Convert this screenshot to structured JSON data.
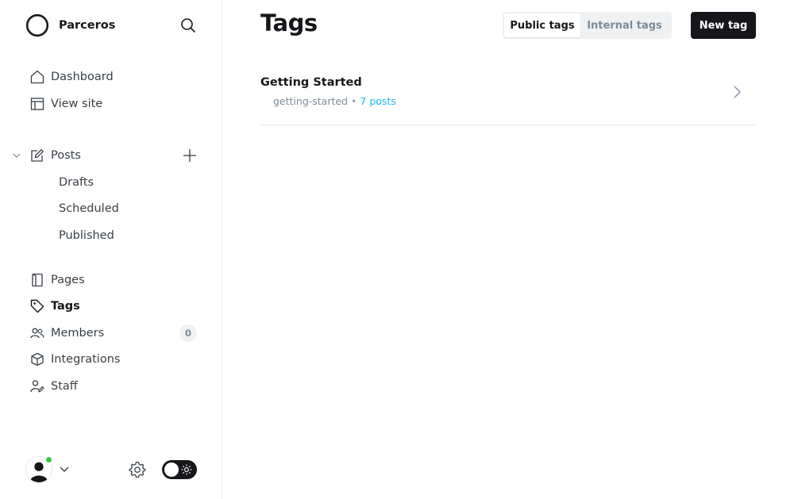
{
  "brand": {
    "name": "Parceros",
    "logo_icon": "ring-logo-icon"
  },
  "search": {
    "icon": "search-icon"
  },
  "nav": {
    "dashboard": "Dashboard",
    "view_site": "View site",
    "posts": "Posts",
    "drafts": "Drafts",
    "scheduled": "Scheduled",
    "published": "Published",
    "pages": "Pages",
    "tags": "Tags",
    "members": "Members",
    "members_count": "0",
    "integrations": "Integrations",
    "staff": "Staff",
    "active_item": "Tags"
  },
  "footer": {
    "user_status": "online",
    "status_color": "#30cf43",
    "theme": "dark-mode-toggle"
  },
  "main": {
    "title": "Tags",
    "filter_tabs": [
      "Public tags",
      "Internal tags"
    ],
    "active_tab": "Public tags",
    "new_button": "New tag"
  },
  "tags": [
    {
      "name": "Getting Started",
      "slug": "getting-started",
      "separator": "•",
      "count": "7 posts"
    }
  ],
  "colors": {
    "accent": "#14b8ff",
    "primary_button": "#15171a",
    "muted_text": "#7c8b9a"
  }
}
